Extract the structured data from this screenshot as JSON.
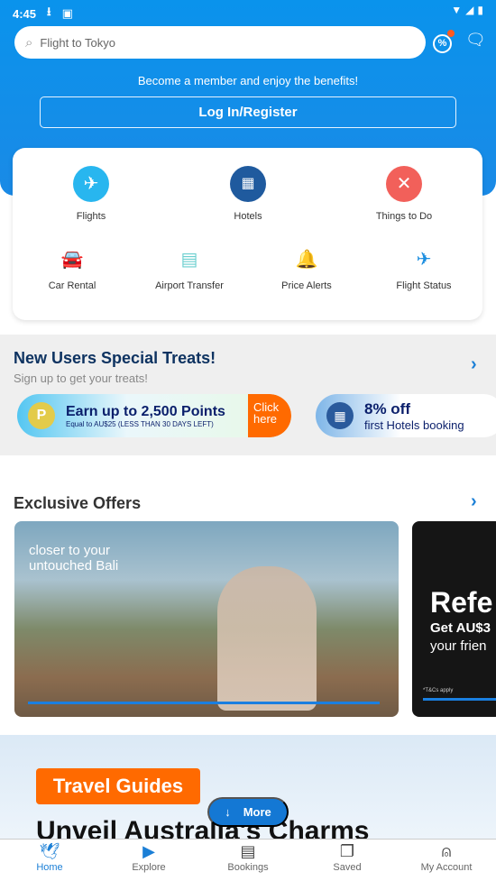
{
  "status_bar": {
    "time": "4:45"
  },
  "header": {
    "search_placeholder": "Flight to Tokyo",
    "member_text": "Become a member and enjoy the benefits!",
    "login_label": "Log In/Register"
  },
  "services": [
    {
      "label": "Flights",
      "icon": "airplane-icon",
      "color": "#28b6ef"
    },
    {
      "label": "Hotels",
      "icon": "hotel-icon",
      "color": "#1f5a9e"
    },
    {
      "label": "Things to Do",
      "icon": "activities-icon",
      "color": "#f2605a"
    },
    {
      "label": "Car Rental",
      "icon": "car-icon",
      "color": "#13707a"
    },
    {
      "label": "Airport Transfer",
      "icon": "transfer-icon",
      "color": "#6ccfcf"
    },
    {
      "label": "Price Alerts",
      "icon": "bell-icon",
      "color": "#1e8fe0"
    },
    {
      "label": "Flight Status",
      "icon": "flight-status-icon",
      "color": "#1e8fe0"
    }
  ],
  "treats": {
    "title": "New Users Special Treats!",
    "subtitle": "Sign up to get your treats!",
    "promo1": {
      "title": "Earn up to 2,500 Points",
      "sub": "Equal to AU$25 (LESS THAN 30 DAYS LEFT)",
      "cta": "Click here"
    },
    "promo2": {
      "title": "8% off",
      "sub": "first Hotels booking"
    }
  },
  "offers": {
    "title": "Exclusive Offers",
    "banner1_text": "closer to your untouched Bali",
    "banner2_title": "Refe",
    "banner2_sub1": "Get AU$3",
    "banner2_sub2": "your frien",
    "banner2_tc": "*T&Cs apply"
  },
  "guides": {
    "badge": "Travel Guides",
    "heading": "Unveil Australia's Charms",
    "more_label": "More"
  },
  "nav": [
    {
      "label": "Home",
      "active": true
    },
    {
      "label": "Explore"
    },
    {
      "label": "Bookings"
    },
    {
      "label": "Saved"
    },
    {
      "label": "My Account"
    }
  ],
  "colors": {
    "brand": "#0a93ec",
    "accent_orange": "#ff6a00",
    "nav_active": "#1b7fd6"
  }
}
